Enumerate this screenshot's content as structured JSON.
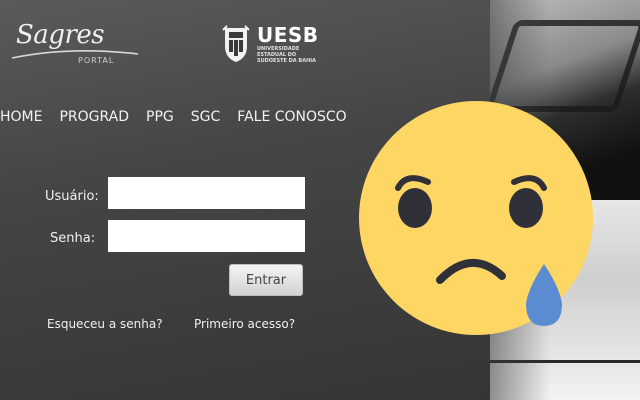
{
  "logo": {
    "sagres_name": "Sagres",
    "sagres_sub": "PORTAL",
    "uesb_title": "UESB",
    "uesb_subtitle": "UNIVERSIDADE ESTADUAL DO SUDOESTE DA BAHIA"
  },
  "nav": {
    "items": [
      {
        "label": "HOME"
      },
      {
        "label": "PROGRAD"
      },
      {
        "label": "PPG"
      },
      {
        "label": "SGC"
      },
      {
        "label": "FALE CONOSCO"
      }
    ]
  },
  "form": {
    "username_label": "Usuário:",
    "username_value": "",
    "password_label": "Senha:",
    "password_value": "",
    "submit_label": "Entrar",
    "forgot_link": "Esqueceu a senha?",
    "first_access_link": "Primeiro acesso?"
  },
  "overlay": {
    "emoji": "sad-crying-face-icon",
    "face_color": "#fdd663",
    "tear_color": "#5b8bd1"
  }
}
